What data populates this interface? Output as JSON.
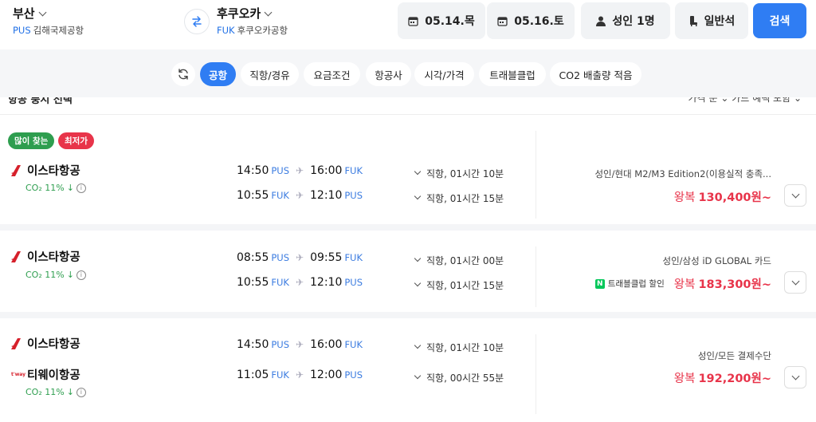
{
  "header": {
    "origin": {
      "city": "부산",
      "code": "PUS",
      "airport": "김해국제공항"
    },
    "destination": {
      "city": "후쿠오카",
      "code": "FUK",
      "airport": "후쿠오카공항"
    },
    "depart_date": "05.14.목",
    "return_date": "05.16.토",
    "passengers": "성인 1명",
    "seat_class": "일반석",
    "search_label": "검색"
  },
  "filters": [
    "공항",
    "직항/경유",
    "요금조건",
    "항공사",
    "시각/가격",
    "트래블클럽",
    "CO2 배출량 적음"
  ],
  "sort": {
    "left": "항공 풍시 선택",
    "right": "가격 순 ⌄   카드 혜택 포함 ⌄"
  },
  "colors": {
    "accent": "#2f7df3",
    "price": "#e8344a",
    "co2": "#2e9e4f",
    "badge_popular": "#2e9e4f",
    "badge_lowest": "#e8344a"
  },
  "badges": {
    "popular": "많이 찾는",
    "lowest": "최저가"
  },
  "results": [
    {
      "airlines": [
        "이스타항공"
      ],
      "co2": "CO₂ 11%",
      "segments": [
        {
          "dep": "14:50",
          "dep_ap": "PUS",
          "arr": "16:00",
          "arr_ap": "FUK",
          "duration": "직항, 01시간 10분"
        },
        {
          "dep": "10:55",
          "dep_ap": "FUK",
          "arr": "12:10",
          "arr_ap": "PUS",
          "duration": "직항, 01시간 15분"
        }
      ],
      "card": "성인/현대 M2/M3 Edition2(이용실적 충족...",
      "price_prefix": "왕복",
      "price": "130,400원~"
    },
    {
      "airlines": [
        "이스타항공"
      ],
      "co2": "CO₂ 11%",
      "segments": [
        {
          "dep": "08:55",
          "dep_ap": "PUS",
          "arr": "09:55",
          "arr_ap": "FUK",
          "duration": "직항, 01시간 00분"
        },
        {
          "dep": "10:55",
          "dep_ap": "FUK",
          "arr": "12:10",
          "arr_ap": "PUS",
          "duration": "직항, 01시간 15분"
        }
      ],
      "card": "성인/삼성 iD GLOBAL 카드",
      "travelclub": "트래블클럽 할인",
      "price_prefix": "왕복",
      "price": "183,300원~"
    },
    {
      "airlines": [
        "이스타항공",
        "티웨이항공"
      ],
      "co2": "CO₂ 11%",
      "segments": [
        {
          "dep": "14:50",
          "dep_ap": "PUS",
          "arr": "16:00",
          "arr_ap": "FUK",
          "duration": "직항, 01시간 10분"
        },
        {
          "dep": "11:05",
          "dep_ap": "FUK",
          "arr": "12:00",
          "arr_ap": "PUS",
          "duration": "직항, 00시간 55분"
        }
      ],
      "card": "성인/모든 결제수단",
      "price_prefix": "왕복",
      "price": "192,200원~"
    }
  ]
}
